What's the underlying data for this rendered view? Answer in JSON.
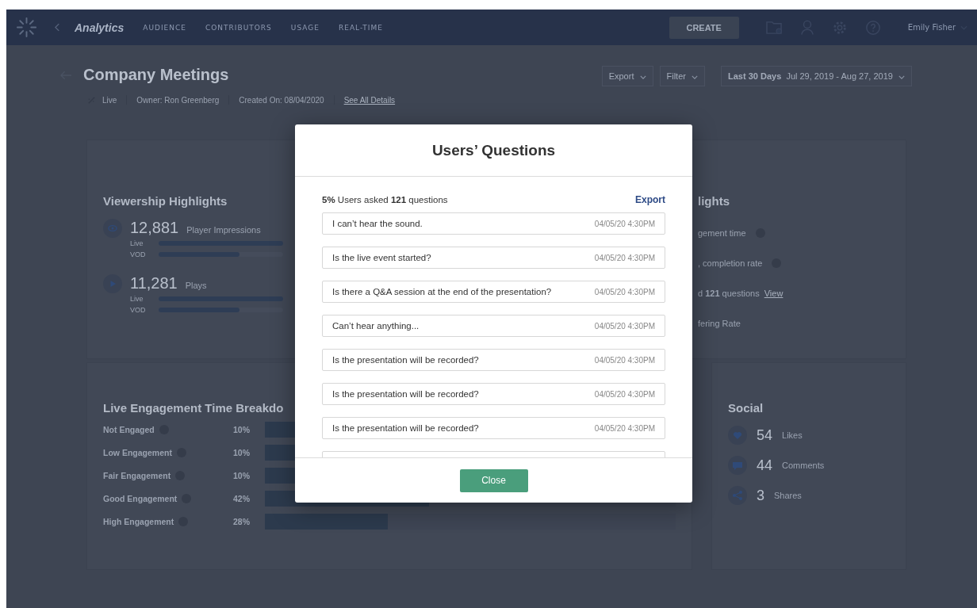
{
  "nav": {
    "title": "Analytics",
    "tabs": [
      {
        "label": "AUDIENCE",
        "selected": false
      },
      {
        "label": "CONTRIBUTORS",
        "selected": false
      },
      {
        "label": "USAGE",
        "selected": false
      },
      {
        "label": "REAL-TIME",
        "selected": false
      }
    ],
    "create_button": "CREATE",
    "user": "Emily Fisher"
  },
  "header": {
    "title": "Company Meetings",
    "status": "Live",
    "owner": "Owner: Ron Greenberg",
    "created": "Created On: 08/04/2020",
    "details_link": "See All Details",
    "export": "Export",
    "filter": "Filter",
    "range_label": "Last 30 Days",
    "range": "Jul 29, 2019 - Aug 27, 2019"
  },
  "viewership": {
    "title": "Viewership Highlights",
    "metrics": [
      {
        "kind": "impressions",
        "value": "12,881",
        "label": "Player Impressions",
        "bars": [
          {
            "label": "Live",
            "level": 1
          },
          {
            "label": "VOD",
            "level": 0.65
          }
        ]
      },
      {
        "kind": "plays",
        "value": "11,281",
        "label": "Plays",
        "bars": [
          {
            "label": "Live",
            "level": 1
          },
          {
            "label": "VOD",
            "level": 0.65
          }
        ]
      }
    ]
  },
  "engagement_highlights": {
    "title": "lights",
    "items": [
      {
        "text": "gement time",
        "help": true
      },
      {
        "text": ", completion rate",
        "help": true
      },
      {
        "text": "d **121** questions",
        "link": "View",
        "help": false
      },
      {
        "text": "fering Rate",
        "help": false
      }
    ]
  },
  "breakdown": {
    "title": "Live Engagement Time Breakdo",
    "rows": [
      {
        "label": "Not Engaged",
        "percent": "10%",
        "level": 0.1
      },
      {
        "label": "Low Engagement",
        "percent": "10%",
        "level": 0.1
      },
      {
        "label": "Fair Engagement",
        "percent": "10%",
        "level": 0.1
      },
      {
        "label": "Good Engagement",
        "percent": "42%",
        "level": 0.4
      },
      {
        "label": "High Engagement",
        "percent": "28%",
        "level": 0.3
      }
    ]
  },
  "social": {
    "title": "Social",
    "items": [
      {
        "kind": "likes",
        "value": "54",
        "label": "Likes"
      },
      {
        "kind": "comments",
        "value": "44",
        "label": "Comments"
      },
      {
        "kind": "shares",
        "value": "3",
        "label": "Shares"
      }
    ]
  },
  "modal": {
    "title": "Users’ Questions",
    "summary": "**5%** Users asked **121** questions",
    "export": "Export",
    "questions": [
      {
        "text": "I can’t hear the sound.",
        "time": "04/05/20 4:30PM"
      },
      {
        "text": "Is the live event started?",
        "time": "04/05/20 4:30PM"
      },
      {
        "text": "Is there a Q&A session at the end of the presentation?",
        "time": "04/05/20 4:30PM"
      },
      {
        "text": "Can’t hear anything...",
        "time": "04/05/20 4:30PM"
      },
      {
        "text": "Is the presentation will be recorded?",
        "time": "04/05/20 4:30PM"
      },
      {
        "text": "Is the presentation will be recorded?",
        "time": "04/05/20 4:30PM"
      },
      {
        "text": "Is the presentation will be recorded?",
        "time": "04/05/20 4:30PM"
      }
    ],
    "close": "Close"
  }
}
